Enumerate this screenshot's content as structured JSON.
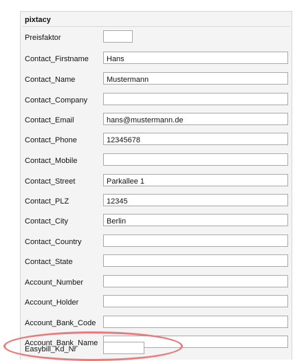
{
  "section": {
    "title": "pixtacy"
  },
  "fields": [
    {
      "label": "Preisfaktor",
      "value": ""
    },
    {
      "label": "Contact_Firstname",
      "value": "Hans"
    },
    {
      "label": "Contact_Name",
      "value": "Mustermann"
    },
    {
      "label": "Contact_Company",
      "value": ""
    },
    {
      "label": "Contact_Email",
      "value": "hans@mustermann.de"
    },
    {
      "label": "Contact_Phone",
      "value": "12345678"
    },
    {
      "label": "Contact_Mobile",
      "value": ""
    },
    {
      "label": "Contact_Street",
      "value": "Parkallee 1"
    },
    {
      "label": "Contact_PLZ",
      "value": "12345"
    },
    {
      "label": "Contact_City",
      "value": "Berlin"
    },
    {
      "label": "Contact_Country",
      "value": ""
    },
    {
      "label": "Contact_State",
      "value": ""
    },
    {
      "label": "Account_Number",
      "value": ""
    },
    {
      "label": "Account_Holder",
      "value": ""
    },
    {
      "label": "Account_Bank_Code",
      "value": ""
    },
    {
      "label": "Account_Bank_Name",
      "value": ""
    },
    {
      "label": "Easybill_Kd_Nr",
      "value": ""
    }
  ],
  "highlight": {
    "color": "#e87c7c"
  }
}
